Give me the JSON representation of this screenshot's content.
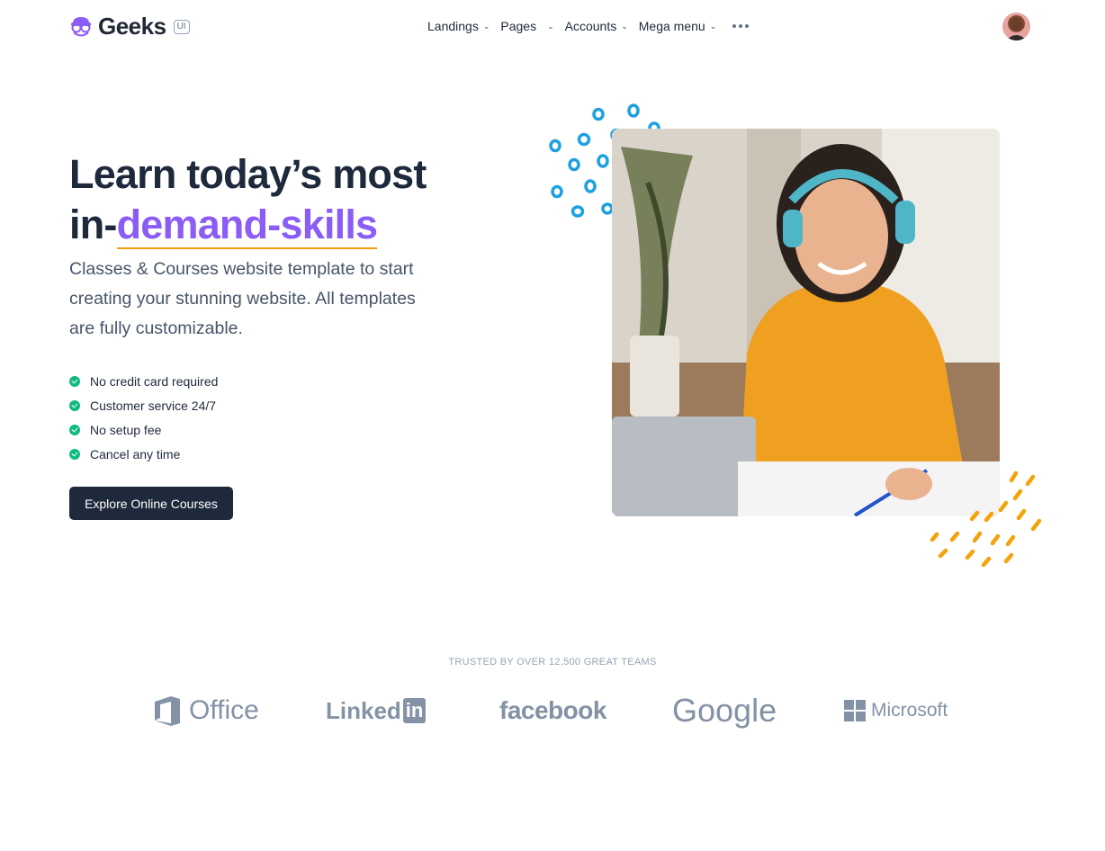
{
  "nav": {
    "brand_name": "Geeks",
    "brand_badge": "UI",
    "menu": [
      {
        "label": "Landings"
      },
      {
        "label": "Pages"
      },
      {
        "label": "Accounts"
      },
      {
        "label": "Mega menu"
      }
    ]
  },
  "hero": {
    "title_line1": "Learn today’s most",
    "title_prefix": "in-",
    "title_accent": "demand-skills",
    "subtitle": "Classes & Courses website template to start creating your stunning website. All templates are fully customizable.",
    "features": [
      "No credit card required",
      "Customer service 24/7",
      "No setup fee",
      "Cancel any time"
    ],
    "cta_label": "Explore Online Courses"
  },
  "trusted": {
    "heading": "TRUSTED BY OVER 12,500 GREAT TEAMS",
    "logos": {
      "office": "Office",
      "linkedin_text": "Linked",
      "linkedin_box": "in",
      "facebook": "facebook",
      "google": "Google",
      "microsoft": "Microsoft"
    }
  },
  "colors": {
    "accent": "#8b5cf6",
    "underline": "#f59e0b",
    "dark": "#1e293b",
    "check": "#10b981",
    "deco_blue": "#1da1e0",
    "deco_orange": "#f5a30a"
  }
}
